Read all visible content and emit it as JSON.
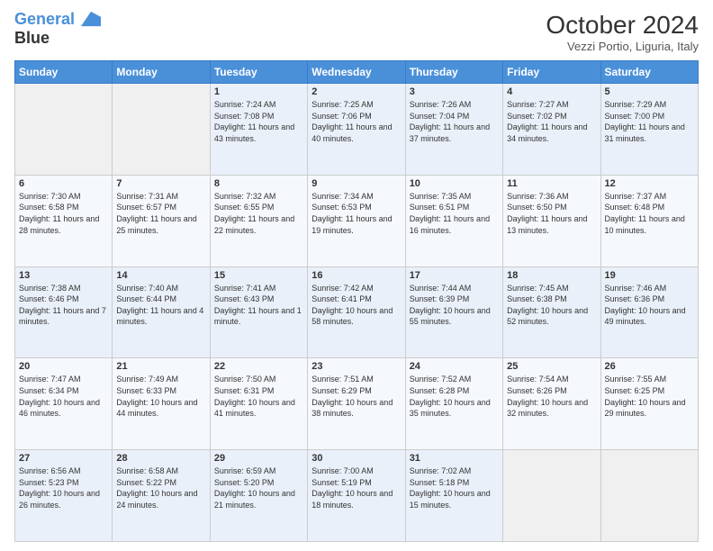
{
  "logo": {
    "line1": "General",
    "line2": "Blue"
  },
  "title": "October 2024",
  "subtitle": "Vezzi Portio, Liguria, Italy",
  "weekdays": [
    "Sunday",
    "Monday",
    "Tuesday",
    "Wednesday",
    "Thursday",
    "Friday",
    "Saturday"
  ],
  "weeks": [
    [
      {
        "day": "",
        "empty": true
      },
      {
        "day": "",
        "empty": true
      },
      {
        "day": "1",
        "sunrise": "7:24 AM",
        "sunset": "7:08 PM",
        "daylight": "11 hours and 43 minutes."
      },
      {
        "day": "2",
        "sunrise": "7:25 AM",
        "sunset": "7:06 PM",
        "daylight": "11 hours and 40 minutes."
      },
      {
        "day": "3",
        "sunrise": "7:26 AM",
        "sunset": "7:04 PM",
        "daylight": "11 hours and 37 minutes."
      },
      {
        "day": "4",
        "sunrise": "7:27 AM",
        "sunset": "7:02 PM",
        "daylight": "11 hours and 34 minutes."
      },
      {
        "day": "5",
        "sunrise": "7:29 AM",
        "sunset": "7:00 PM",
        "daylight": "11 hours and 31 minutes."
      }
    ],
    [
      {
        "day": "6",
        "sunrise": "7:30 AM",
        "sunset": "6:58 PM",
        "daylight": "11 hours and 28 minutes."
      },
      {
        "day": "7",
        "sunrise": "7:31 AM",
        "sunset": "6:57 PM",
        "daylight": "11 hours and 25 minutes."
      },
      {
        "day": "8",
        "sunrise": "7:32 AM",
        "sunset": "6:55 PM",
        "daylight": "11 hours and 22 minutes."
      },
      {
        "day": "9",
        "sunrise": "7:34 AM",
        "sunset": "6:53 PM",
        "daylight": "11 hours and 19 minutes."
      },
      {
        "day": "10",
        "sunrise": "7:35 AM",
        "sunset": "6:51 PM",
        "daylight": "11 hours and 16 minutes."
      },
      {
        "day": "11",
        "sunrise": "7:36 AM",
        "sunset": "6:50 PM",
        "daylight": "11 hours and 13 minutes."
      },
      {
        "day": "12",
        "sunrise": "7:37 AM",
        "sunset": "6:48 PM",
        "daylight": "11 hours and 10 minutes."
      }
    ],
    [
      {
        "day": "13",
        "sunrise": "7:38 AM",
        "sunset": "6:46 PM",
        "daylight": "11 hours and 7 minutes."
      },
      {
        "day": "14",
        "sunrise": "7:40 AM",
        "sunset": "6:44 PM",
        "daylight": "11 hours and 4 minutes."
      },
      {
        "day": "15",
        "sunrise": "7:41 AM",
        "sunset": "6:43 PM",
        "daylight": "11 hours and 1 minute."
      },
      {
        "day": "16",
        "sunrise": "7:42 AM",
        "sunset": "6:41 PM",
        "daylight": "10 hours and 58 minutes."
      },
      {
        "day": "17",
        "sunrise": "7:44 AM",
        "sunset": "6:39 PM",
        "daylight": "10 hours and 55 minutes."
      },
      {
        "day": "18",
        "sunrise": "7:45 AM",
        "sunset": "6:38 PM",
        "daylight": "10 hours and 52 minutes."
      },
      {
        "day": "19",
        "sunrise": "7:46 AM",
        "sunset": "6:36 PM",
        "daylight": "10 hours and 49 minutes."
      }
    ],
    [
      {
        "day": "20",
        "sunrise": "7:47 AM",
        "sunset": "6:34 PM",
        "daylight": "10 hours and 46 minutes."
      },
      {
        "day": "21",
        "sunrise": "7:49 AM",
        "sunset": "6:33 PM",
        "daylight": "10 hours and 44 minutes."
      },
      {
        "day": "22",
        "sunrise": "7:50 AM",
        "sunset": "6:31 PM",
        "daylight": "10 hours and 41 minutes."
      },
      {
        "day": "23",
        "sunrise": "7:51 AM",
        "sunset": "6:29 PM",
        "daylight": "10 hours and 38 minutes."
      },
      {
        "day": "24",
        "sunrise": "7:52 AM",
        "sunset": "6:28 PM",
        "daylight": "10 hours and 35 minutes."
      },
      {
        "day": "25",
        "sunrise": "7:54 AM",
        "sunset": "6:26 PM",
        "daylight": "10 hours and 32 minutes."
      },
      {
        "day": "26",
        "sunrise": "7:55 AM",
        "sunset": "6:25 PM",
        "daylight": "10 hours and 29 minutes."
      }
    ],
    [
      {
        "day": "27",
        "sunrise": "6:56 AM",
        "sunset": "5:23 PM",
        "daylight": "10 hours and 26 minutes."
      },
      {
        "day": "28",
        "sunrise": "6:58 AM",
        "sunset": "5:22 PM",
        "daylight": "10 hours and 24 minutes."
      },
      {
        "day": "29",
        "sunrise": "6:59 AM",
        "sunset": "5:20 PM",
        "daylight": "10 hours and 21 minutes."
      },
      {
        "day": "30",
        "sunrise": "7:00 AM",
        "sunset": "5:19 PM",
        "daylight": "10 hours and 18 minutes."
      },
      {
        "day": "31",
        "sunrise": "7:02 AM",
        "sunset": "5:18 PM",
        "daylight": "10 hours and 15 minutes."
      },
      {
        "day": "",
        "empty": true
      },
      {
        "day": "",
        "empty": true
      }
    ]
  ]
}
